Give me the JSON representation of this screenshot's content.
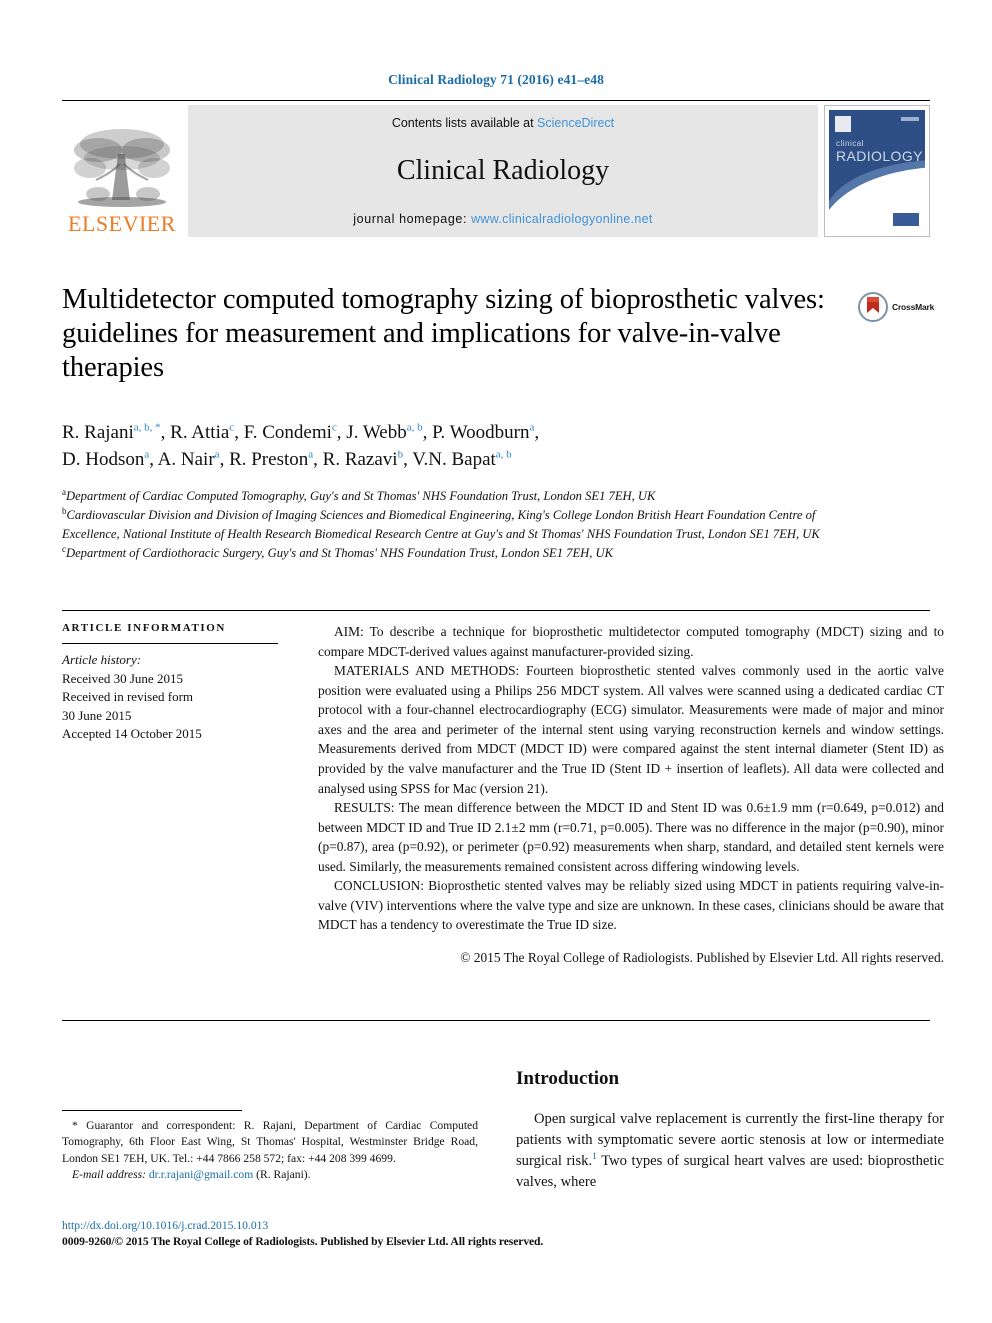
{
  "running_head": "Clinical Radiology 71 (2016) e41–e48",
  "masthead": {
    "publisher_name": "ELSEVIER",
    "contents_prefix": "Contents lists available at ",
    "contents_link": "ScienceDirect",
    "journal_name": "Clinical Radiology",
    "homepage_prefix": "journal homepage: ",
    "homepage_url": "www.clinicalradiologyonline.net",
    "cover": {
      "line1": "clinical",
      "line2": "RADIOLOGY"
    }
  },
  "title": "Multidetector computed tomography sizing of bioprosthetic valves: guidelines for measurement and implications for valve-in-valve therapies",
  "crossmark_label": "CrossMark",
  "authors_line1": "R. Rajani a, b, *, R. Attia c, F. Condemi c, J. Webb a, b, P. Woodburn a,",
  "authors_line2": "D. Hodson a, A. Nair a, R. Preston a, R. Razavi b, V.N. Bapat a, b",
  "affiliations": [
    {
      "marker": "a",
      "text": "Department of Cardiac Computed Tomography, Guy's and St Thomas' NHS Foundation Trust, London SE1 7EH, UK"
    },
    {
      "marker": "b",
      "text": "Cardiovascular Division and Division of Imaging Sciences and Biomedical Engineering, King's College London British Heart Foundation Centre of Excellence, National Institute of Health Research Biomedical Research Centre at Guy's and St Thomas' NHS Foundation Trust, London SE1 7EH, UK"
    },
    {
      "marker": "c",
      "text": "Department of Cardiothoracic Surgery, Guy's and St Thomas' NHS Foundation Trust, London SE1 7EH, UK"
    }
  ],
  "article_information": {
    "heading": "Article information",
    "history_label": "Article history:",
    "history": [
      "Received 30 June 2015",
      "Received in revised form",
      "30 June 2015",
      "Accepted 14 October 2015"
    ]
  },
  "abstract": {
    "aim": "AIM: To describe a technique for bioprosthetic multidetector computed tomography (MDCT) sizing and to compare MDCT-derived values against manufacturer-provided sizing.",
    "materials": "MATERIALS AND METHODS: Fourteen bioprosthetic stented valves commonly used in the aortic valve position were evaluated using a Philips 256 MDCT system. All valves were scanned using a dedicated cardiac CT protocol with a four-channel electrocardiography (ECG) simulator. Measurements were made of major and minor axes and the area and perimeter of the internal stent using varying reconstruction kernels and window settings. Measurements derived from MDCT (MDCT ID) were compared against the stent internal diameter (Stent ID) as provided by the valve manufacturer and the True ID (Stent ID + insertion of leaflets). All data were collected and analysed using SPSS for Mac (version 21).",
    "results": "RESULTS: The mean difference between the MDCT ID and Stent ID was 0.6±1.9 mm (r=0.649, p=0.012) and between MDCT ID and True ID 2.1±2 mm (r=0.71, p=0.005). There was no difference in the major (p=0.90), minor (p=0.87), area (p=0.92), or perimeter (p=0.92) measurements when sharp, standard, and detailed stent kernels were used. Similarly, the measurements remained consistent across differing windowing levels.",
    "conclusion": "CONCLUSION: Bioprosthetic stented valves may be reliably sized using MDCT in patients requiring valve-in-valve (VIV) interventions where the valve type and size are unknown. In these cases, clinicians should be aware that MDCT has a tendency to overestimate the True ID size.",
    "copyright": "© 2015 The Royal College of Radiologists. Published by Elsevier Ltd. All rights reserved."
  },
  "footnote": {
    "correspondence": "* Guarantor and correspondent: R. Rajani, Department of Cardiac Computed Tomography, 6th Floor East Wing, St Thomas' Hospital, Westminster Bridge Road, London SE1 7EH, UK. Tel.: +44 7866 258 572; fax: +44 208 399 4699.",
    "email_label": "E-mail address:",
    "email": "dr.r.rajani@gmail.com",
    "email_suffix": "(R. Rajani)."
  },
  "doi_block": {
    "doi_url": "http://dx.doi.org/10.1016/j.crad.2015.10.013",
    "issn_line": "0009-9260/© 2015 The Royal College of Radiologists. Published by Elsevier Ltd. All rights reserved."
  },
  "introduction": {
    "heading": "Introduction",
    "paragraph_part1": "Open surgical valve replacement is currently the first-line therapy for patients with symptomatic severe aortic stenosis at low or intermediate surgical risk.",
    "reference_marker": "1",
    "paragraph_part2": " Two types of surgical heart valves are used: bioprosthetic valves, where"
  },
  "colors": {
    "link_blue": "#1b6ca8",
    "sciencedirect_blue": "#3f93d6",
    "elsevier_orange": "#ec7b24",
    "band_grey": "#e6e6e6",
    "cover_blue": "#2d4f85"
  }
}
